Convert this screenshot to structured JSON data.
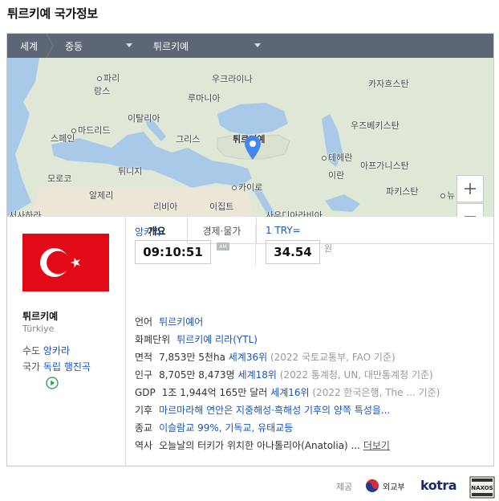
{
  "page_title": "튀르키예 국가정보",
  "breadcrumb": {
    "world": "세계",
    "region": "중동",
    "country": "튀르키예"
  },
  "map": {
    "labels": {
      "ukraine": "우크라이나",
      "kazakhstan": "카자흐스탄",
      "paris": "파리",
      "france": "랑스",
      "romania": "루마니아",
      "madrid": "마드리드",
      "spain": "스페인",
      "italy": "이탈리아",
      "uzbekistan": "우즈베키스탄",
      "greece": "그리스",
      "turkey": "튀르키예",
      "tehran": "테헤란",
      "morocco": "모로코",
      "tunisia": "튀니지",
      "iran": "이란",
      "afghanistan": "아프가니스탄",
      "algeria": "알제리",
      "cairo": "카이로",
      "pakistan": "파키스탄",
      "newdelhi": "뉴",
      "libya": "리비아",
      "egypt": "이집트",
      "westernsahara": "서사하라",
      "saudi": "사우디아라비아"
    },
    "zoom_in": "+",
    "zoom_out": "−"
  },
  "country": {
    "name": "튀르키예",
    "name_en": "Türkiye",
    "capital_label": "수도",
    "capital": "앙카라",
    "anthem_label": "국가",
    "anthem": "독립 행진곡"
  },
  "tabs": [
    "개요",
    "경제·물가"
  ],
  "time": {
    "city": "앙카라",
    "value": "09:10:51",
    "ampm": "AM"
  },
  "exchange": {
    "label": "1 TRY=",
    "value": "34.54",
    "unit": "원"
  },
  "info": {
    "language": {
      "label": "언어",
      "value": "튀르키예어"
    },
    "currency": {
      "label": "화폐단위",
      "value": "튀르키예 리라(YTL)"
    },
    "area": {
      "label": "면적",
      "value": "7,853만 5천ha",
      "rank": "세계36위",
      "source": "(2022 국토교통부, FAO 기준)"
    },
    "population": {
      "label": "인구",
      "value": "8,705만 8,473명",
      "rank": "세계18위",
      "source": "(2022 통계청, UN, 대만통계청 기준)"
    },
    "gdp": {
      "label": "GDP",
      "value": "1조 1,944억 165만 달러",
      "rank": "세계16위",
      "source": "(2022 한국은행, The ...",
      "source_end": "기준)"
    },
    "climate": {
      "label": "기후",
      "value": "마르마라해 연안은 지중해성·흑해성 기후의 양쪽 특성을..."
    },
    "religion": {
      "label": "종교",
      "value": "이슬람교 99%, 기독교, 유태교등"
    },
    "history": {
      "label": "역사",
      "value": "오늘날의 터키가 위치한 아나톨리아(Anatolia) ...",
      "more": "더보기"
    }
  },
  "footer": {
    "source_label": "제공",
    "mofa": "외교부",
    "kotra": "kotra",
    "naxos": "NAXOS"
  },
  "colors": {
    "nav_bg": "#5d6675",
    "link": "#1a55b8",
    "flag_red": "#e30a17",
    "pin": "#4285f4"
  }
}
